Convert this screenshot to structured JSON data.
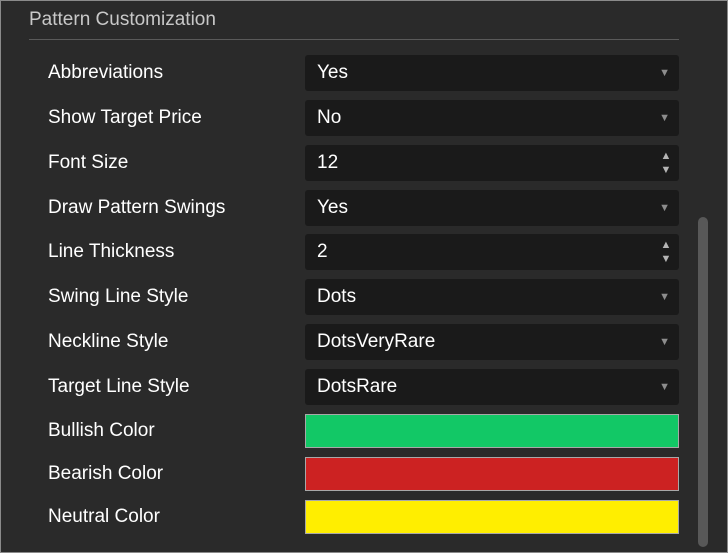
{
  "section": {
    "title": "Pattern Customization"
  },
  "settings": [
    {
      "label": "Abbreviations",
      "value": "Yes",
      "control": "dropdown"
    },
    {
      "label": "Show Target Price",
      "value": "No",
      "control": "dropdown"
    },
    {
      "label": "Font Size",
      "value": "12",
      "control": "spinner"
    },
    {
      "label": "Draw Pattern Swings",
      "value": "Yes",
      "control": "dropdown"
    },
    {
      "label": "Line Thickness",
      "value": "2",
      "control": "spinner"
    },
    {
      "label": "Swing Line Style",
      "value": "Dots",
      "control": "dropdown"
    },
    {
      "label": "Neckline Style",
      "value": "DotsVeryRare",
      "control": "dropdown"
    },
    {
      "label": "Target Line Style",
      "value": "DotsRare",
      "control": "dropdown"
    },
    {
      "label": "Bullish Color",
      "color": "#12c866",
      "control": "color"
    },
    {
      "label": "Bearish Color",
      "color": "#cc2222",
      "control": "color"
    },
    {
      "label": "Neutral Color",
      "color": "#ffee00",
      "control": "color"
    }
  ],
  "icons": {
    "dropdown": "chevron-down-icon",
    "spinner": "spinner-arrows-icon"
  }
}
